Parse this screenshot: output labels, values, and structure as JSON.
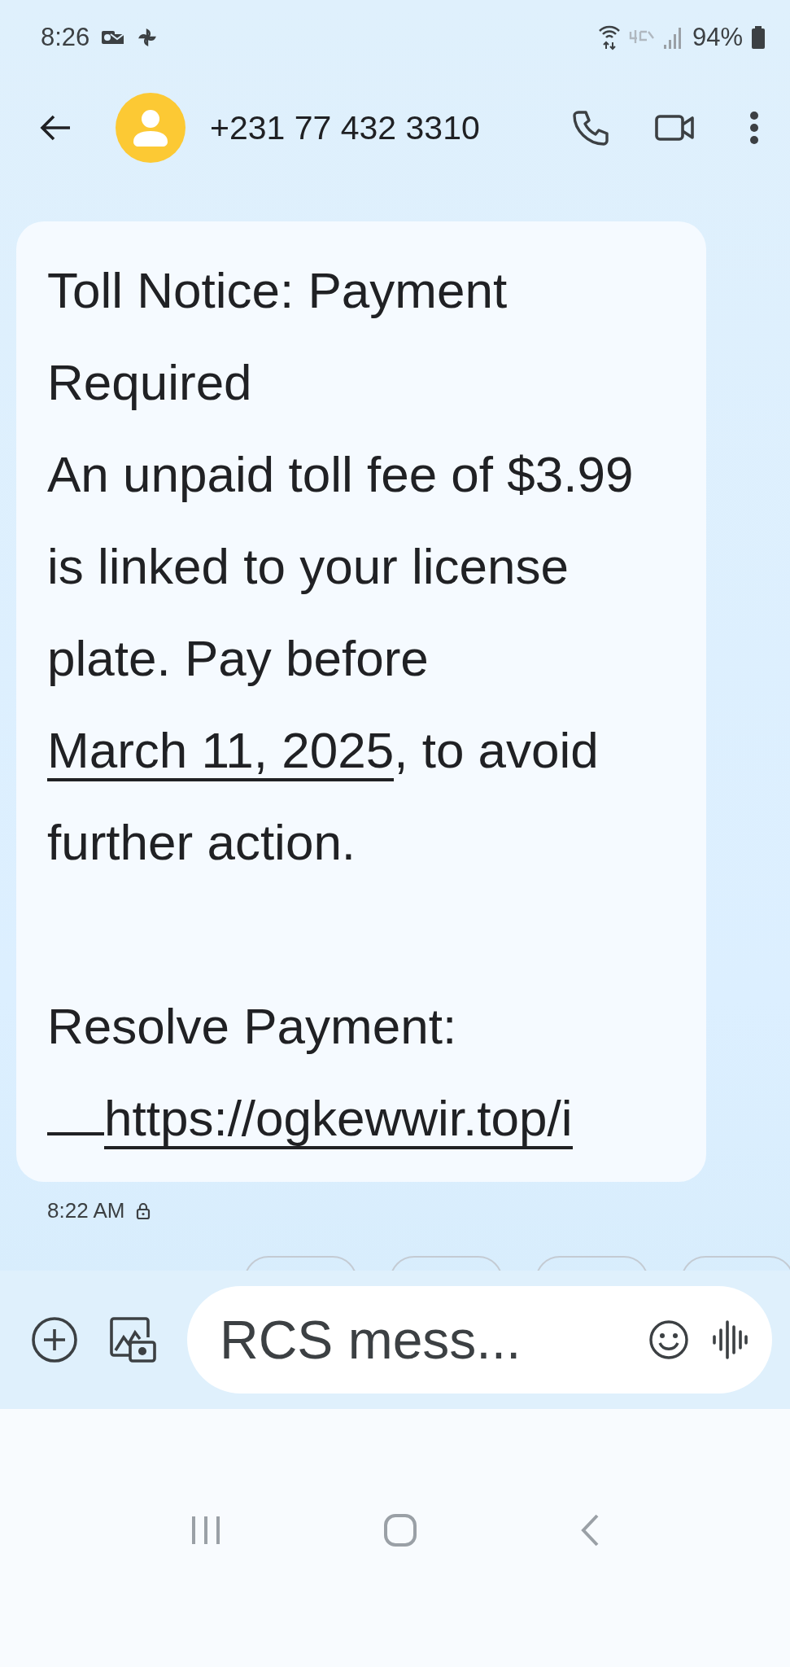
{
  "status_bar": {
    "time": "8:26",
    "battery": "94%"
  },
  "header": {
    "contact": "+231 77 432 3310"
  },
  "message": {
    "title": "Toll Notice: Payment Required",
    "body_before": "An unpaid toll fee of $3.99 is linked to your license plate. Pay before ",
    "date_link": "March 11, 2025",
    "body_after": ", to avoid further action.",
    "resolve_label": "Resolve Payment:",
    "url": "https://ogkewwir.top/i",
    "time": "8:22 AM"
  },
  "composer": {
    "placeholder": "RCS mess..."
  }
}
